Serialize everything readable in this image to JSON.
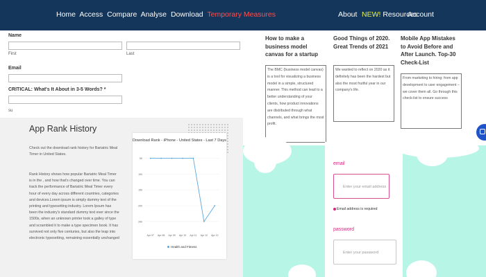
{
  "nav": {
    "left_items": [
      "Home",
      "Access",
      "Compare",
      "Analyse",
      "Download"
    ],
    "highlight_item": "Temporary Measures",
    "about": "About",
    "new_badge": "NEW!",
    "resources": "Resources",
    "account": "Account"
  },
  "form": {
    "name_label": "Name",
    "first_label": "First",
    "last_label": "Last",
    "email_label": "Email",
    "critical_label": "CRITICAL: What's It About in 3-5 Words? *",
    "submit_partial": "su"
  },
  "rank": {
    "title": "App Rank History",
    "intro": "Check out the download rank history for Bariatric Meal Timer in United States.",
    "body": "Rank History shows how popular Bariatric Meal Timer is in the , and how that's changed over time. You can track the performance of Bariatric Meal Timer every hour of every day across different countries, categories and devices.Lorem ipsum is simply dummy text of the printing and typesetting industry. Lorem Ipsum has been the industry's standard dummy text ever since the 1500s, when an unknown printer took a galley of type and scrambled it to make a type specimen book. It has survived not only five centuries, but also the leap into electronic typesetting, remaining essentially unchanged"
  },
  "chart_data": {
    "type": "line",
    "title": "Download Rank - iPhone - United States - Last 7 Days",
    "categories": [
      "Apr 07",
      "Apr 08",
      "Apr 09",
      "Apr 10",
      "Apr 11",
      "Apr 12",
      "Apr 13"
    ],
    "y_tick_labels": [
      "50",
      "100",
      "150",
      "200",
      "250"
    ],
    "ylim": [
      40,
      270
    ],
    "y_inverted": true,
    "series": [
      {
        "name": "Health and Fitness",
        "values": [
          50,
          50,
          50,
          50,
          50,
          250,
          200
        ],
        "color": "#5aa7de"
      }
    ]
  },
  "blogs": [
    {
      "title": "How to make a business model canvas for a startup",
      "excerpt": "The BMC (business model canvas) is a tool for visualizing a business model in a simple, structured manner. This method can lead to a better understanding of your clients, how product innovations are distributed through what channels, and what brings the most profit."
    },
    {
      "title": "Good Things of 2020. Great Trends of 2021",
      "excerpt": "We wanted to reflect on 2020 as it definitely has been the hardest but also the most fruitful year in our company's life."
    },
    {
      "title": "Mobile App Mistakes to Avoid Before and After Launch. Top-30 Check-List",
      "excerpt": "From marketing to hiring: from app development to user engagement – we cover them all. Go through this check-list to ensure success"
    }
  ],
  "login": {
    "email_label": "email",
    "email_placeholder": "Enter your email address",
    "email_error": "Email address is required",
    "password_label": "password",
    "password_placeholder": "Enter your password"
  },
  "colors": {
    "topbar": "#14365a",
    "accent_red": "#ff4f4f",
    "accent_yellow": "#e9f24a",
    "mint": "#b7f5e6",
    "pink": "#d4287d",
    "chat": "#1f54c9"
  },
  "icons": {
    "chat": "chat-bubble-icon"
  }
}
